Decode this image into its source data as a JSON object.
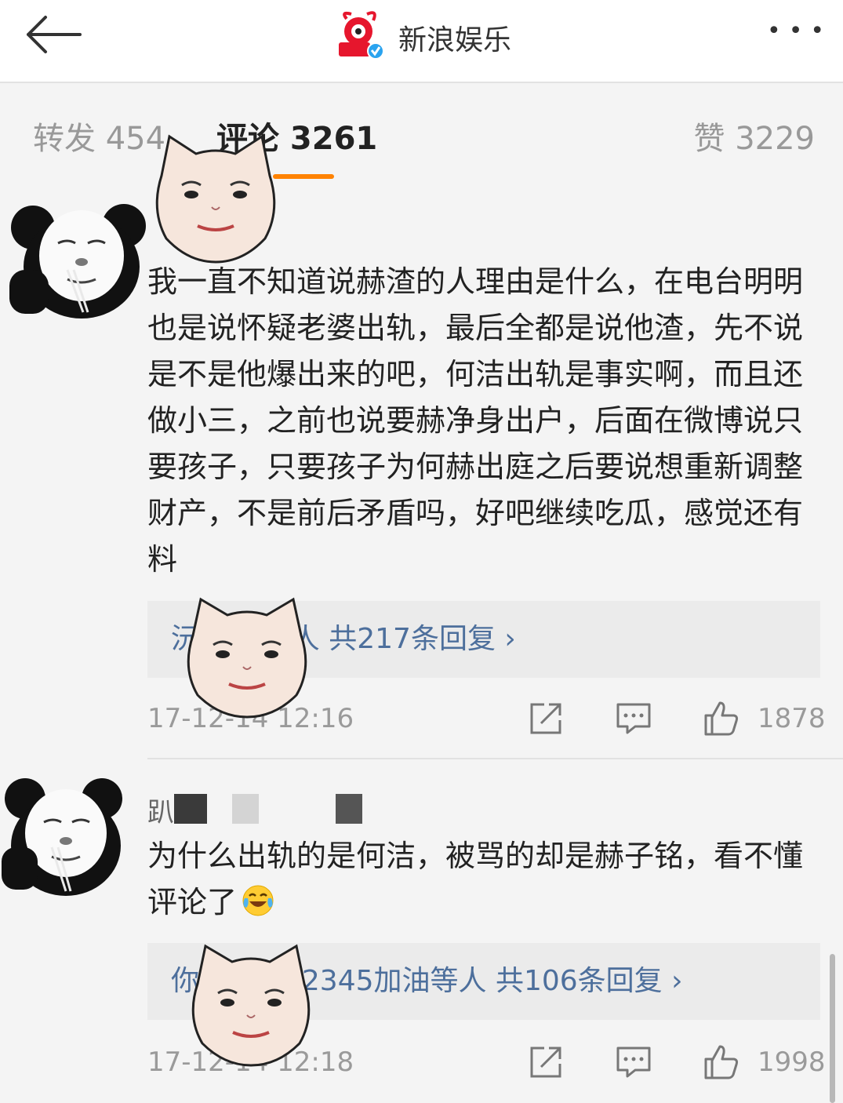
{
  "header": {
    "title": "新浪娱乐",
    "more_label": "•••"
  },
  "tabs": {
    "repost": "转发 454",
    "comment": "评论 3261",
    "like": "赞 3229"
  },
  "comments": [
    {
      "text": "我一直不知道说赫渣的人理由是什么，在电台明明也是说怀疑老婆出轨，最后全都是说他渣，先不说是不是他爆出来的吧，何洁出轨是事实啊，而且还做小三，之前也说要赫净身出户，后面在微博说只要孩子，只要孩子为何赫出庭之后要说想重新调整财产，不是前后矛盾吗，好吧继续吃瓜，感觉还有料",
      "replies": "沅…47等人  共217条回复 ›",
      "time": "17-12-14 12:16",
      "likes": "1878"
    },
    {
      "name": "趴",
      "text": "为什么出轨的是何洁，被骂的却是赫子铭，看不懂评论了",
      "replies": "你…风景12345加油等人  共106条回复 ›",
      "time": "17-12-14 12:18",
      "likes": "1998"
    }
  ],
  "icons": {
    "back": "back-arrow-icon",
    "repost": "share-icon",
    "reply": "comment-icon",
    "like": "thumbs-up-icon",
    "emoji": "laughing-crying-emoji-icon"
  },
  "colors": {
    "accent": "#ff8200",
    "link": "#4d6f9c",
    "muted": "#9a9a9a"
  }
}
